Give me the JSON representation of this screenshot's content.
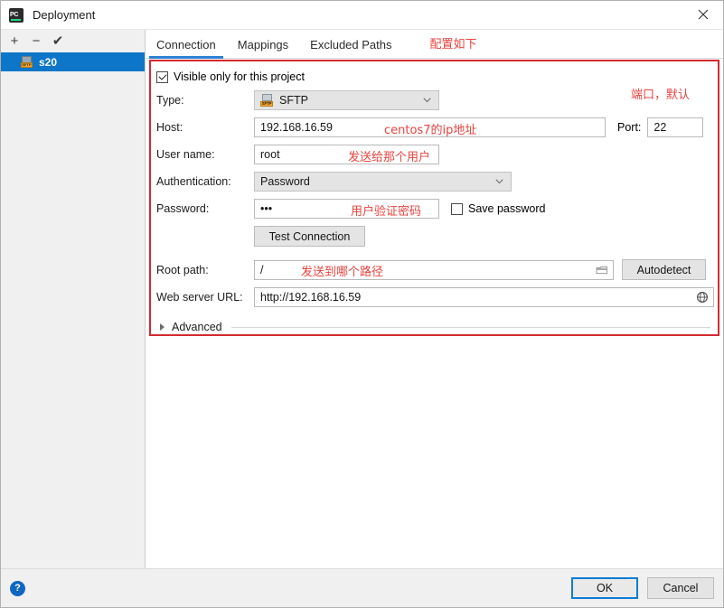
{
  "window": {
    "title": "Deployment",
    "app_icon": "pycharm-icon",
    "close_icon": "close-icon"
  },
  "sidebar": {
    "toolbar": [
      {
        "name": "add-button",
        "glyph": "+"
      },
      {
        "name": "remove-button",
        "glyph": "−"
      },
      {
        "name": "set-default-button",
        "glyph": "✔"
      }
    ],
    "items": [
      {
        "label": "s20",
        "icon": "sftp-server-icon",
        "selected": true
      }
    ]
  },
  "tabs": [
    {
      "label": "Connection",
      "active": true
    },
    {
      "label": "Mappings",
      "active": false
    },
    {
      "label": "Excluded Paths",
      "active": false
    }
  ],
  "annotations": {
    "header_note": "配置如下",
    "port_note": "端口，默认",
    "host_note": "centos7的ip地址",
    "user_note": "发送给那个用户",
    "password_note": "用户验证密码",
    "rootpath_note": "发送到哪个路径",
    "box_color": "#d32a30",
    "text_color": "#e8433f"
  },
  "form": {
    "visible_only": {
      "label": "Visible only for this project",
      "checked": true
    },
    "type": {
      "label": "Type:",
      "value": "SFTP",
      "icon": "sftp-icon"
    },
    "host": {
      "label": "Host:",
      "value": "192.168.16.59"
    },
    "port": {
      "label": "Port:",
      "value": "22"
    },
    "username": {
      "label": "User name:",
      "value": "root"
    },
    "authentication": {
      "label": "Authentication:",
      "value": "Password"
    },
    "password": {
      "label": "Password:",
      "value": "•••"
    },
    "save_password": {
      "label": "Save password",
      "checked": false
    },
    "test_connection": {
      "label": "Test Connection"
    },
    "root_path": {
      "label": "Root path:",
      "value": "/",
      "browse_icon": "folder-icon"
    },
    "autodetect": {
      "label": "Autodetect"
    },
    "web_server_url": {
      "label": "Web server URL:",
      "value": "http://192.168.16.59",
      "open_icon": "globe-icon"
    },
    "advanced": {
      "label": "Advanced",
      "expanded": false
    }
  },
  "footer": {
    "help_label": "?",
    "ok_label": "OK",
    "cancel_label": "Cancel"
  },
  "theme": {
    "selection_blue": "#0d76c8",
    "tab_underline": "#2d7fd3",
    "default_button_border": "#0c7cd5"
  }
}
